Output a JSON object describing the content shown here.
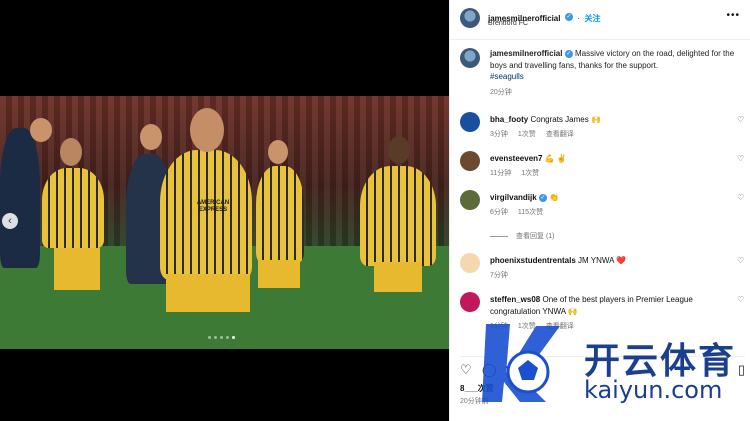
{
  "post": {
    "author": "jamesmilnerofficial",
    "follow_label": "关注",
    "location": "Brentford FC",
    "caption": "Massive victory on the road, delighted for the boys and travelling fans, thanks for the support.",
    "hashtag": "#seagulls",
    "caption_time": "20分钟"
  },
  "comments": [
    {
      "user": "bha_footy",
      "text": "Congrats James 🙌",
      "time": "3分钟",
      "likes": "1次赞",
      "action": "查看翻译",
      "avatar_color": "#1a4fa0"
    },
    {
      "user": "evensteeven7",
      "text": "💪 ✌️",
      "time": "11分钟",
      "likes": "1次赞",
      "action": "",
      "avatar_color": "#6b4a2f"
    },
    {
      "user": "virgilvandijk",
      "text": "👏",
      "time": "6分钟",
      "likes": "115次赞",
      "action": "",
      "avatar_color": "#5b6b3a"
    },
    {
      "user": "phoenixstudentrentals",
      "text": "JM YNWA ❤️",
      "time": "7分钟",
      "likes": "",
      "action": "",
      "avatar_color": "#f4d9b0"
    },
    {
      "user": "steffen_ws08",
      "text": "One of the best players in Premier League congratulation YNWA 🙌",
      "time": "1分钟",
      "likes": "1次赞",
      "action": "查看翻译",
      "avatar_color": "#c2185b"
    }
  ],
  "view_replies": "查看回复 (1)",
  "footer": {
    "likes": "8___次赞",
    "time": "20分钟前"
  },
  "jersey_text": "AMERICAN EXPRESS",
  "watermark": {
    "title": "开云体育",
    "subtitle": "kaiyun.com"
  }
}
